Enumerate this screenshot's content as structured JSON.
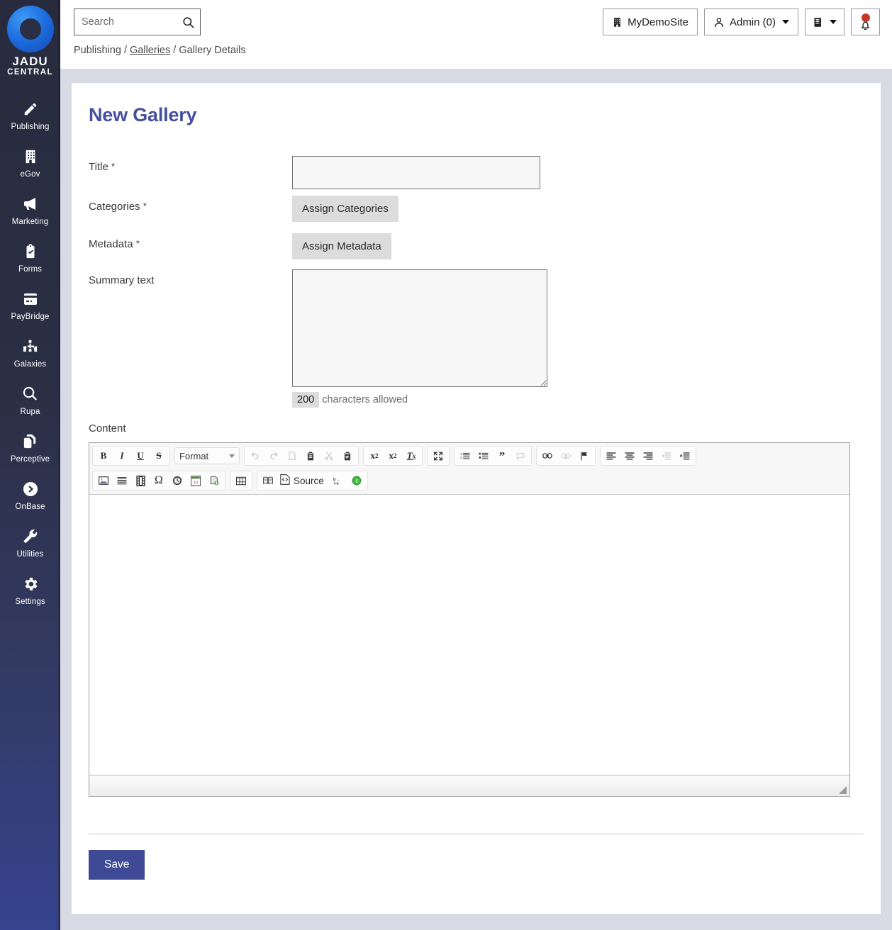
{
  "brand": {
    "line1": "JADU",
    "line2": "CENTRAL"
  },
  "sidebar": {
    "items": [
      {
        "label": "Publishing",
        "icon": "pencil-icon"
      },
      {
        "label": "eGov",
        "icon": "building-icon"
      },
      {
        "label": "Marketing",
        "icon": "megaphone-icon"
      },
      {
        "label": "Forms",
        "icon": "clipboard-check-icon"
      },
      {
        "label": "PayBridge",
        "icon": "credit-card-icon"
      },
      {
        "label": "Galaxies",
        "icon": "sitemap-icon"
      },
      {
        "label": "Rupa",
        "icon": "magnifier-icon"
      },
      {
        "label": "Perceptive",
        "icon": "copy-documents-icon"
      },
      {
        "label": "OnBase",
        "icon": "circle-arrow-right-icon"
      },
      {
        "label": "Utilities",
        "icon": "wrench-icon"
      },
      {
        "label": "Settings",
        "icon": "gear-icon"
      }
    ]
  },
  "header": {
    "search": {
      "placeholder": "Search",
      "value": "",
      "icon": "search-icon"
    },
    "site_button": {
      "label": "MyDemoSite",
      "icon": "building-icon"
    },
    "user_button": {
      "label": "Admin (0)",
      "icon": "user-icon",
      "caret": "chevron-down-icon"
    },
    "book_button": {
      "label": "",
      "icon": "book-icon",
      "caret": "chevron-down-icon"
    },
    "notifications_button": {
      "label": "",
      "icon": "bell-icon",
      "badge_color": "#c0392b"
    }
  },
  "breadcrumb": {
    "root": "Publishing",
    "sep1": "/",
    "link": "Galleries",
    "sep2": "/",
    "current": "Gallery Details"
  },
  "page": {
    "title": "New Gallery",
    "title_color": "#454f9e"
  },
  "form": {
    "title_field": {
      "label": "Title",
      "required_mark": "*",
      "value": "",
      "placeholder": ""
    },
    "categories": {
      "label": "Categories",
      "required_mark": "*",
      "button_label": "Assign Categories"
    },
    "metadata": {
      "label": "Metadata",
      "required_mark": "*",
      "button_label": "Assign Metadata"
    },
    "summary": {
      "label": "Summary text",
      "value": "",
      "placeholder": "",
      "char_count": "200",
      "char_note": "characters allowed"
    },
    "content": {
      "label": "Content",
      "value": ""
    },
    "save_label": "Save"
  },
  "editor": {
    "format_select": {
      "value": "Format",
      "caret": "chevron-down-icon"
    },
    "source_label": "Source",
    "row1": [
      {
        "group": [
          {
            "name": "bold-icon",
            "glyph": "B",
            "style": "bold",
            "dim": false
          },
          {
            "name": "italic-icon",
            "glyph": "I",
            "style": "italic",
            "dim": false
          },
          {
            "name": "underline-icon",
            "glyph": "U",
            "style": "underline",
            "dim": false
          },
          {
            "name": "strikethrough-icon",
            "glyph": "S",
            "style": "strike",
            "dim": false
          }
        ]
      },
      {
        "group": [
          {
            "name": "subscript-icon",
            "glyph": "x₂",
            "style": "plain",
            "dim": false
          },
          {
            "name": "superscript-icon",
            "glyph": "x²",
            "style": "plain",
            "dim": false
          },
          {
            "name": "remove-format-icon",
            "glyph": "Tx",
            "style": "plain",
            "dim": false
          }
        ]
      },
      {
        "group": [
          {
            "name": "maximize-icon",
            "glyph": "⤢",
            "style": "plain",
            "dim": false
          }
        ]
      },
      {
        "group": [
          {
            "name": "numbered-list-icon",
            "glyph": "≡",
            "style": "plain",
            "dim": false
          },
          {
            "name": "bulleted-list-icon",
            "glyph": "≔",
            "style": "plain",
            "dim": false
          },
          {
            "name": "blockquote-icon",
            "glyph": "❞",
            "style": "plain",
            "dim": false
          },
          {
            "name": "comment-icon",
            "glyph": "🗨",
            "style": "plain",
            "dim": true
          }
        ]
      },
      {
        "group": [
          {
            "name": "link-icon",
            "glyph": "🔗",
            "style": "plain",
            "dim": false
          },
          {
            "name": "unlink-icon",
            "glyph": "⛓",
            "style": "plain",
            "dim": true
          },
          {
            "name": "anchor-flag-icon",
            "glyph": "⚑",
            "style": "plain",
            "dim": false
          }
        ]
      },
      {
        "group": [
          {
            "name": "align-left-icon",
            "glyph": "≡",
            "style": "plain",
            "dim": false
          },
          {
            "name": "align-center-icon",
            "glyph": "≡",
            "style": "plain",
            "dim": false
          },
          {
            "name": "align-right-icon",
            "glyph": "≡",
            "style": "plain",
            "dim": false
          },
          {
            "name": "outdent-icon",
            "glyph": "⇤",
            "style": "plain",
            "dim": true
          },
          {
            "name": "indent-icon",
            "glyph": "⇥",
            "style": "plain",
            "dim": false
          }
        ]
      }
    ],
    "row2": [
      {
        "group": [
          {
            "name": "image-icon",
            "dim": false
          },
          {
            "name": "horizontal-rule-icon",
            "dim": false
          },
          {
            "name": "video-filmstrip-icon",
            "dim": false
          },
          {
            "name": "special-character-icon",
            "glyph": "Ω",
            "dim": false
          },
          {
            "name": "clock-icon",
            "dim": false
          },
          {
            "name": "calendar-icon",
            "glyph": "10",
            "dim": false
          },
          {
            "name": "insert-document-icon",
            "dim": false
          }
        ]
      },
      {
        "group": [
          {
            "name": "table-icon",
            "dim": false
          }
        ]
      },
      {
        "group": [
          {
            "name": "reading-book-icon",
            "dim": false
          },
          {
            "name": "source-icon",
            "dim": false
          },
          {
            "name": "find-replace-icon",
            "dim": false
          },
          {
            "name": "info-icon",
            "dim": false
          }
        ]
      }
    ]
  }
}
